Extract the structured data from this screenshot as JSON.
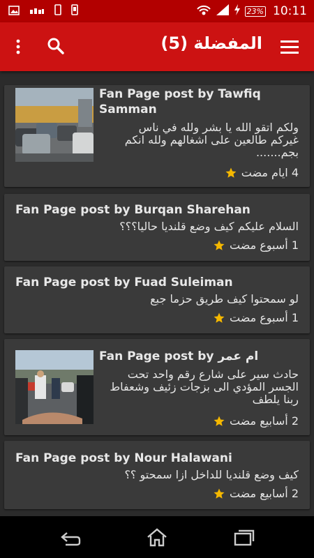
{
  "status_bar": {
    "battery": "23%",
    "time": "10:11",
    "icons": [
      "image-icon",
      "signal-dots-icon",
      "phone-icon",
      "phone-vibrate-icon",
      "wifi-hotspot-icon",
      "signal-icon",
      "charging-icon",
      "battery-icon"
    ]
  },
  "app_bar": {
    "title": "المفضلة (5)",
    "icons": [
      "overflow-menu-icon",
      "search-icon",
      "hamburger-menu-icon"
    ]
  },
  "posts": [
    {
      "title_line1": "Fan Page post by Tawfiq",
      "title_line2": "Samman",
      "body_line1": "ولكم اتقو الله يا بشر ولله في ناس",
      "body_line2": "غيركم طالعين على اشغالهم ولله انكم",
      "body_line3": "بجم.......",
      "time": "4 ايام مضت",
      "has_image": true
    },
    {
      "title_line1": "Fan Page post by Burqan Sharehan",
      "body_line1": "السلام عليكم كيف وضع قلنديا حاليا؟؟؟",
      "time": "1 أسبوع مضت",
      "has_image": false
    },
    {
      "title_line1": "Fan Page post by Fuad Suleiman",
      "body_line1": "لو سمحتوا كيف طريق حزما جبع",
      "time": "1 أسبوع مضت",
      "has_image": false
    },
    {
      "title_line1": "Fan Page post by ام عمر",
      "body_line1": "حادث سير على شارع رقم واحد تحت",
      "body_line2": "الجسر المؤدي الى بزجات زئيف وشعفاط",
      "body_line3": "ربنا يلطف",
      "time": "2 أسابيع مضت",
      "has_image": true
    },
    {
      "title_line1": "Fan Page post by Nour Halawani",
      "body_line1": "كيف وضع قلنديا للداخل ازا سمحتو ؟؟",
      "time": "2 أسابيع مضت",
      "has_image": false
    }
  ],
  "nav_bar": {
    "icons": [
      "back-icon",
      "home-icon",
      "recents-icon"
    ]
  },
  "colors": {
    "status_bar": "#b20000",
    "app_bar": "#cc1212",
    "background": "#2b2b2b",
    "card": "#3a3a3a",
    "star": "#f5b800"
  }
}
